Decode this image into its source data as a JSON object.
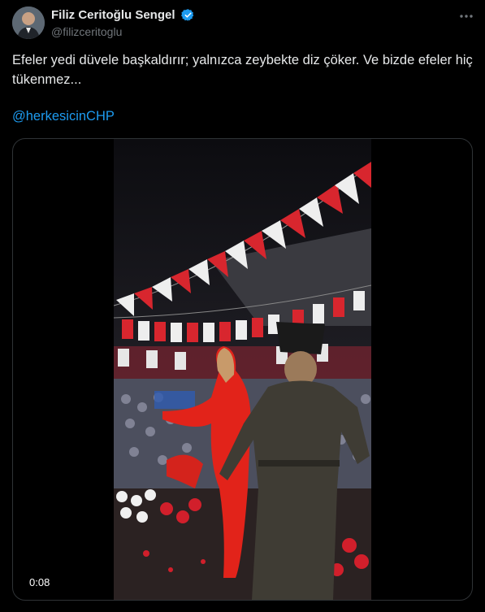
{
  "author": {
    "display_name": "Filiz Ceritoğlu Sengel",
    "handle": "@filizceritoglu"
  },
  "tweet": {
    "text": "Efeler yedi düvele başkaldırır; yalnızca zeybekte diz çöker. Ve bizde efeler hiç tükenmez...",
    "hashtag": "@herkesicinCHP"
  },
  "media": {
    "type": "video",
    "duration": "0:08"
  },
  "icons": {
    "verified": "verified-badge-icon",
    "more": "more-options-icon"
  },
  "colors": {
    "background": "#000000",
    "link": "#1d9bf0",
    "verified": "#1d9bf0"
  }
}
